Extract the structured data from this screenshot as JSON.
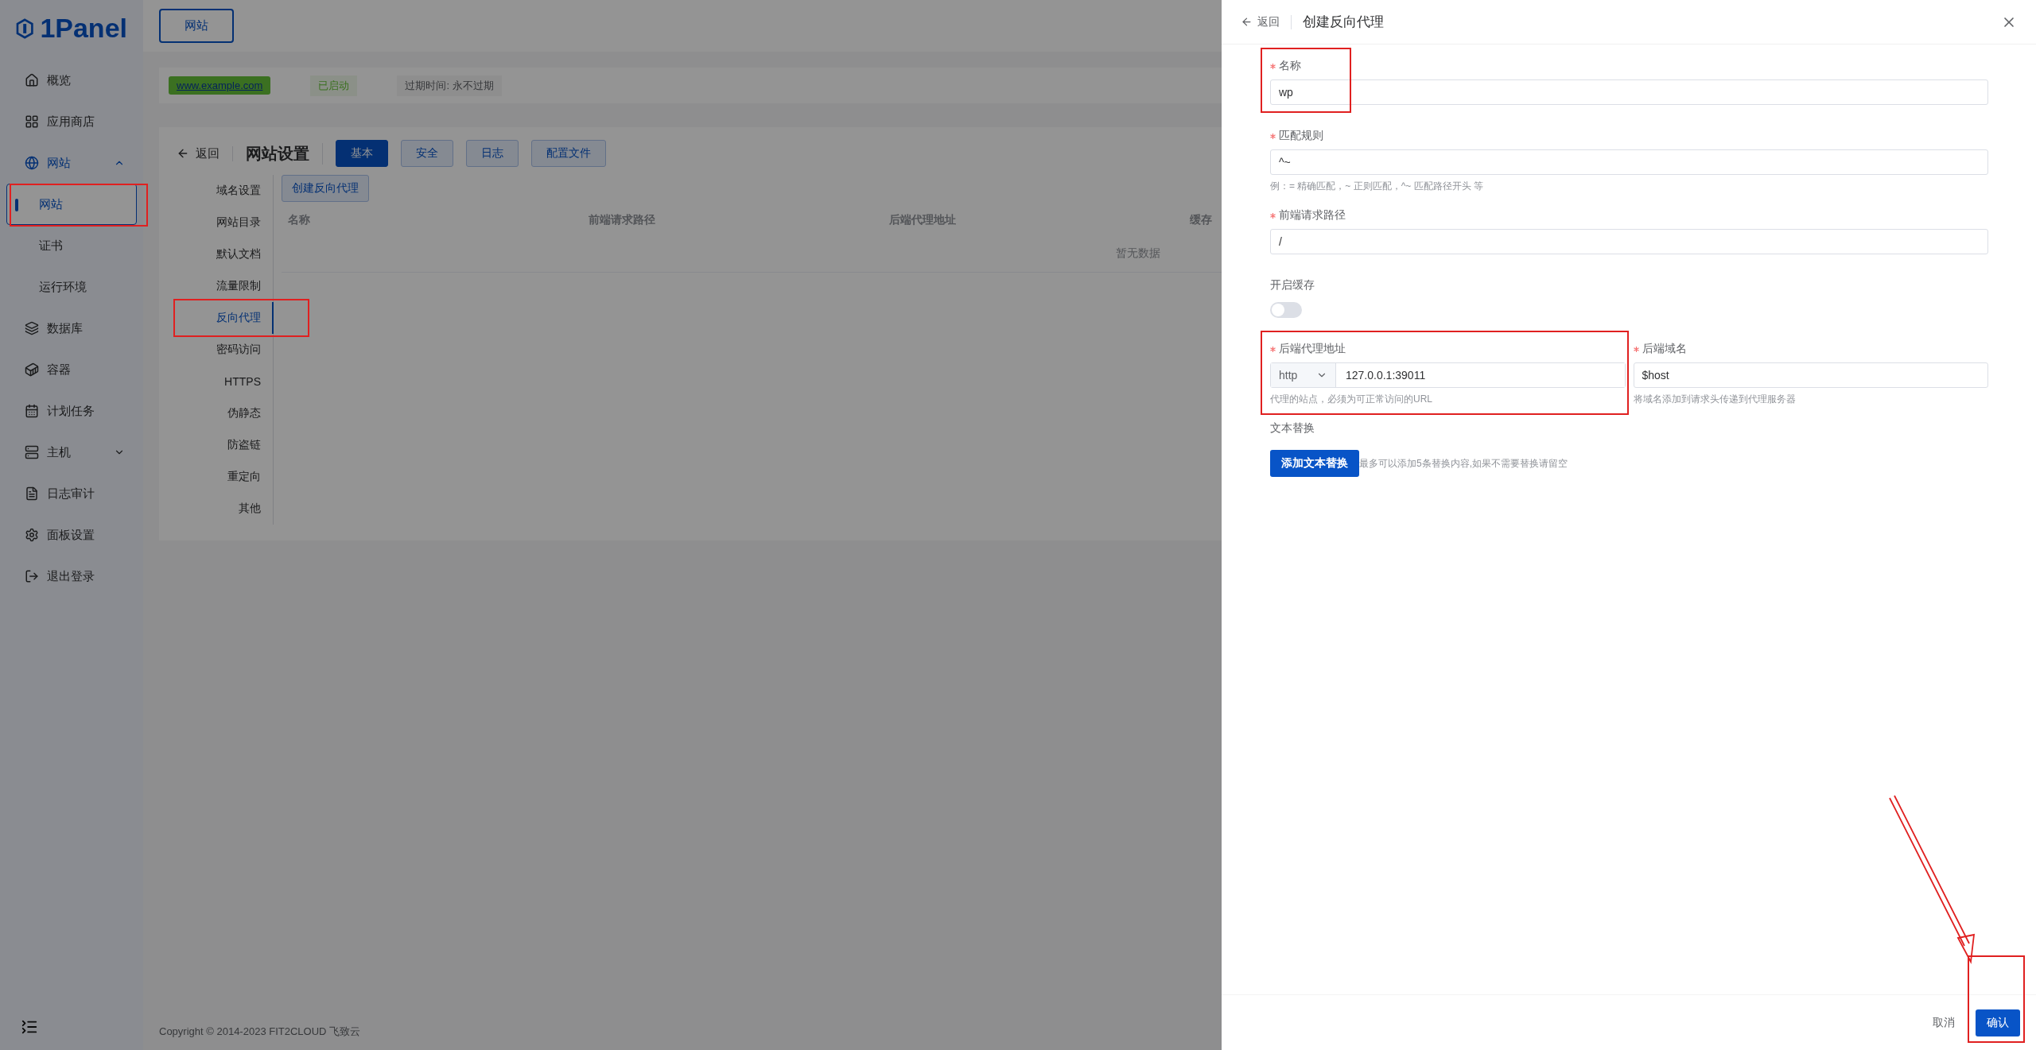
{
  "sidebar": {
    "logo": "1Panel",
    "items": [
      {
        "label": "概览",
        "selected": false
      },
      {
        "label": "应用商店",
        "selected": false
      },
      {
        "label": "网站",
        "selected": true,
        "expanded": true,
        "children": [
          {
            "label": "网站",
            "selected": true,
            "highlighted": true
          },
          {
            "label": "证书",
            "selected": false
          },
          {
            "label": "运行环境",
            "selected": false
          }
        ]
      },
      {
        "label": "数据库",
        "selected": false
      },
      {
        "label": "容器",
        "selected": false
      },
      {
        "label": "计划任务",
        "selected": false
      },
      {
        "label": "主机",
        "selected": false,
        "expanded": false
      },
      {
        "label": "日志审计",
        "selected": false
      },
      {
        "label": "面板设置",
        "selected": false
      },
      {
        "label": "退出登录",
        "selected": false
      }
    ]
  },
  "top_tabs": [
    {
      "label": "网站",
      "selected": true
    }
  ],
  "site_bar": {
    "domain": "www.example.com",
    "status": "已启动",
    "expiry": "过期时间: 永不过期"
  },
  "settings": {
    "back": "返回",
    "title": "网站设置",
    "tabs": [
      {
        "label": "基本",
        "selected": true
      },
      {
        "label": "安全",
        "selected": false
      },
      {
        "label": "日志",
        "selected": false
      },
      {
        "label": "配置文件",
        "selected": false
      }
    ],
    "menu": [
      {
        "label": "域名设置",
        "selected": false
      },
      {
        "label": "网站目录",
        "selected": false
      },
      {
        "label": "默认文档",
        "selected": false
      },
      {
        "label": "流量限制",
        "selected": false
      },
      {
        "label": "反向代理",
        "selected": true,
        "highlighted": true
      },
      {
        "label": "密码访问",
        "selected": false
      },
      {
        "label": "HTTPS",
        "selected": false
      },
      {
        "label": "伪静态",
        "selected": false
      },
      {
        "label": "防盗链",
        "selected": false
      },
      {
        "label": "重定向",
        "selected": false
      },
      {
        "label": "其他",
        "selected": false
      }
    ],
    "create_button": "创建反向代理",
    "table": {
      "columns": [
        "名称",
        "前端请求路径",
        "后端代理地址",
        "缓存"
      ],
      "empty": "暂无数据"
    }
  },
  "footer": "Copyright © 2014-2023 FIT2CLOUD 飞致云",
  "drawer": {
    "back": "返回",
    "title": "创建反向代理",
    "fields": [
      {
        "kind": "text",
        "label": "名称",
        "required": true,
        "value": "wp",
        "highlighted": true
      },
      {
        "kind": "text",
        "label": "匹配规则",
        "required": true,
        "value": "^~",
        "hint": "例：= 精确匹配，~ 正则匹配，^~ 匹配路径开头 等"
      },
      {
        "kind": "text",
        "label": "前端请求路径",
        "required": true,
        "value": "/"
      },
      {
        "kind": "switch",
        "label": "开启缓存",
        "on": false
      },
      {
        "kind": "pair",
        "items": [
          {
            "label": "后端代理地址",
            "required": true,
            "scheme": "http",
            "value": "127.0.0.1:39011",
            "hint": "代理的站点，必须为可正常访问的URL",
            "highlighted": true
          },
          {
            "label": "后端域名",
            "required": true,
            "value": "$host",
            "hint": "将域名添加到请求头传递到代理服务器"
          }
        ]
      },
      {
        "kind": "action",
        "label": "文本替换",
        "button": "添加文本替换",
        "hint": "最多可以添加5条替换内容,如果不需要替换请留空"
      }
    ],
    "buttons": [
      {
        "label": "取消",
        "kind": "plain"
      },
      {
        "label": "确认",
        "kind": "primary",
        "highlighted": true
      }
    ]
  },
  "annotation_arrow": true
}
